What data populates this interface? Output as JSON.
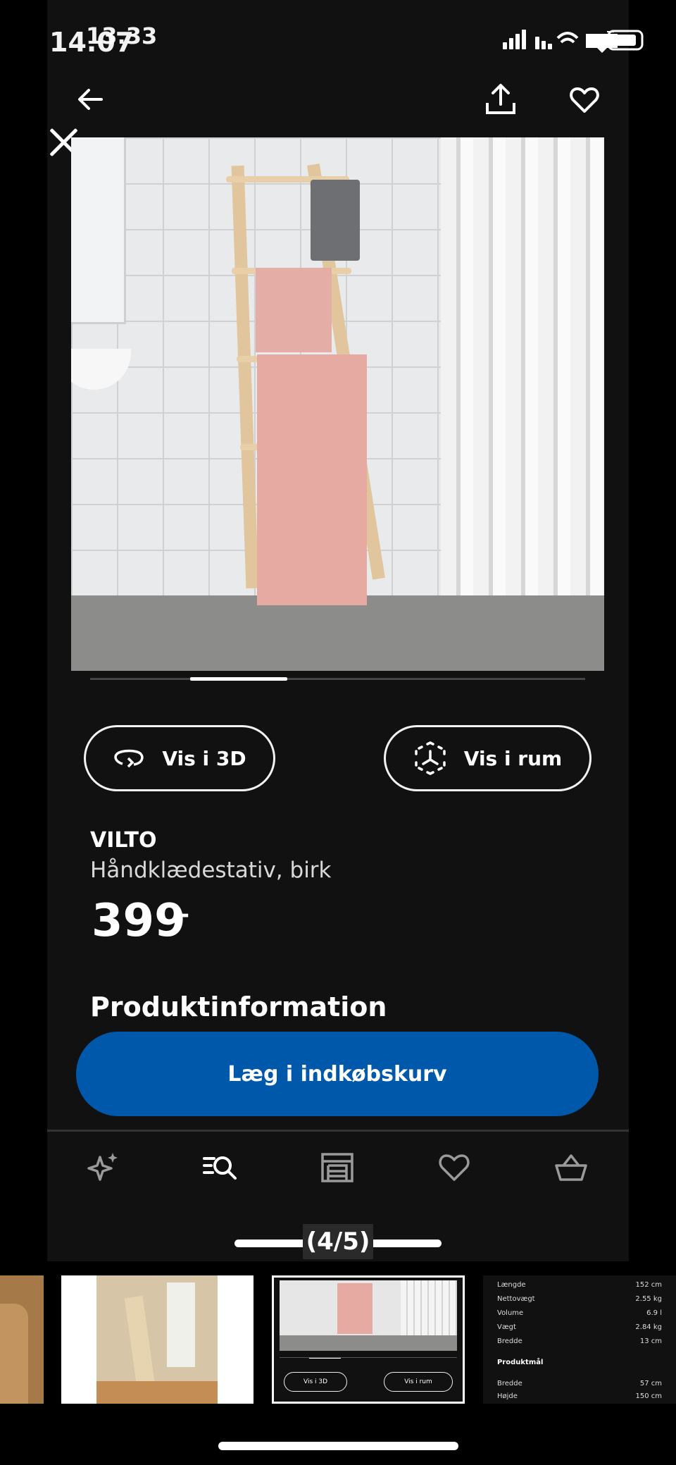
{
  "overlay": {
    "time_a": "14.07",
    "time_b": "13.33",
    "counter": "(4/5)"
  },
  "product": {
    "brand": "VILTO",
    "description": "Håndklædestativ, birk",
    "price": "399",
    "price_suffix": ".-",
    "section_title": "Produktinformation"
  },
  "actions": {
    "view_3d": "Vis i 3D",
    "view_room": "Vis i rum",
    "add_to_cart": "Læg i indkøbskurv"
  },
  "tabs": [
    {
      "icon": "sparkle-icon"
    },
    {
      "icon": "search-list-icon"
    },
    {
      "icon": "store-icon"
    },
    {
      "icon": "heart-icon"
    },
    {
      "icon": "basket-icon"
    }
  ],
  "thumbnail_specs": {
    "rows": [
      {
        "label": "Længde",
        "value": "152 cm"
      },
      {
        "label": "Nettovægt",
        "value": "2.55 kg"
      },
      {
        "label": "Volume",
        "value": "6.9 l"
      },
      {
        "label": "Vægt",
        "value": "2.84 kg"
      },
      {
        "label": "Bredde",
        "value": "13 cm"
      }
    ],
    "heading": "Produktmål",
    "rows2": [
      {
        "label": "Bredde",
        "value": "57 cm"
      },
      {
        "label": "Højde",
        "value": "150 cm"
      }
    ]
  },
  "colors": {
    "accent": "#0058ab",
    "background": "#111112"
  }
}
